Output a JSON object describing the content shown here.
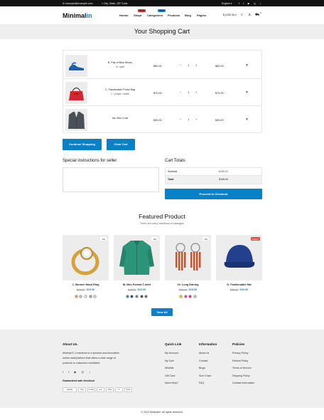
{
  "topbar": {
    "email": "✉ example@example.com",
    "address": "⌖ City, State, ZIP Code",
    "language": "English ▾"
  },
  "logo": {
    "prefix": "Minimal",
    "suffix": "in"
  },
  "nav": [
    {
      "label": "Home",
      "arrow": "▾"
    },
    {
      "label": "Shop",
      "arrow": "▾",
      "badge": "New"
    },
    {
      "label": "Categories",
      "arrow": "▾",
      "badge": "Sale"
    },
    {
      "label": "Products",
      "arrow": ""
    },
    {
      "label": "Blog",
      "arrow": ""
    },
    {
      "label": "Pages",
      "arrow": "▾"
    }
  ],
  "currency": "$ (USD $) ▾",
  "cart_count": "0",
  "page_title": "Your Shopping Cart",
  "cart_items": [
    {
      "name": "B. Pair of Blue Shoes",
      "variant": "m / gold",
      "price": "$80.00",
      "qty": "1",
      "total": "$80.00",
      "image": "blue-shoes-image"
    },
    {
      "name": "C. Fashionable Purse Bag",
      "variant": "L / purple / metal",
      "price": "$70.00",
      "qty": "1",
      "total": "$70.00",
      "image": "red-purse-image"
    },
    {
      "name": "Aa. Men Coat",
      "variant": "",
      "price": "$35.00",
      "qty": "1",
      "total": "$35.00",
      "image": "men-coat-image"
    }
  ],
  "buttons": {
    "continue": "Continue Shopping",
    "clear": "Clear Cart",
    "checkout": "Proceed to Checkout",
    "view_all": "View All"
  },
  "instructions": {
    "title": "Special instructions for seller"
  },
  "totals": {
    "title": "Cart Totals",
    "subtotal_label": "Subtotal",
    "subtotal": "$185.00",
    "total_label": "Total",
    "total": "$185.00"
  },
  "featured": {
    "title": "Featured Product",
    "subtitle": "There are many variations of passages"
  },
  "products": [
    {
      "name": "J. Women Hand Ring",
      "old": "$18.00",
      "price": "$19.00",
      "tag": "-6%",
      "image": "gold-ring-image",
      "swatches": [
        "#c8a45a",
        "#bbbbbb",
        "#dddddd",
        "#999999",
        "#cccccc"
      ]
    },
    {
      "name": "W. Men Formal T-shirt",
      "old": "$18.00",
      "price": "$15.00",
      "tag": "-6%",
      "image": "green-shirt-image",
      "swatches": [
        "#2a8a70",
        "#1e3b78",
        "#777777",
        "#334455",
        "#666666"
      ]
    },
    {
      "name": "Ve. Long Earring",
      "old": "$25.00",
      "price": "$18.00",
      "tag": "-6%",
      "image": "earring-image",
      "swatches": [
        "#f2c200",
        "#c23fc2",
        "#e01f7a",
        "#bbbbbb"
      ]
    },
    {
      "name": "D. Fashionable Hat",
      "old": "$35.00",
      "price": "$30.00",
      "tag": "Soldout",
      "image": "blue-hat-image",
      "swatches": []
    }
  ],
  "footer": {
    "about_title": "About Us.",
    "about_text": [
      "Minimal E-Commerce is a dynamic and innovative",
      "online retail platform that offers a wide range of",
      "products to customers worldwide."
    ],
    "guaranteed": "Guaranteed safe checkout",
    "payments": [
      "shopify",
      "Pay",
      "G Pay",
      "●●",
      "ePay",
      "P",
      "VISA"
    ],
    "cols": [
      {
        "title": "Quick Link",
        "links": [
          "My Account",
          "My Cart",
          "Wishlist",
          "Gift Card",
          "Need Help?"
        ]
      },
      {
        "title": "Information",
        "links": [
          "About us",
          "Contact",
          "Blogs",
          "Size Chart",
          "FAQ"
        ]
      },
      {
        "title": "Policies",
        "links": [
          "Privacy Policy",
          "Refund Policy",
          "Terms of Service",
          "Shipping Policy",
          "Contact Information"
        ]
      }
    ],
    "copyright": "© 2023 Minimalin. All rights reserved."
  },
  "colors": {
    "accent": "#0a80c6",
    "banner": "#efefef",
    "topbar": "#111111"
  }
}
